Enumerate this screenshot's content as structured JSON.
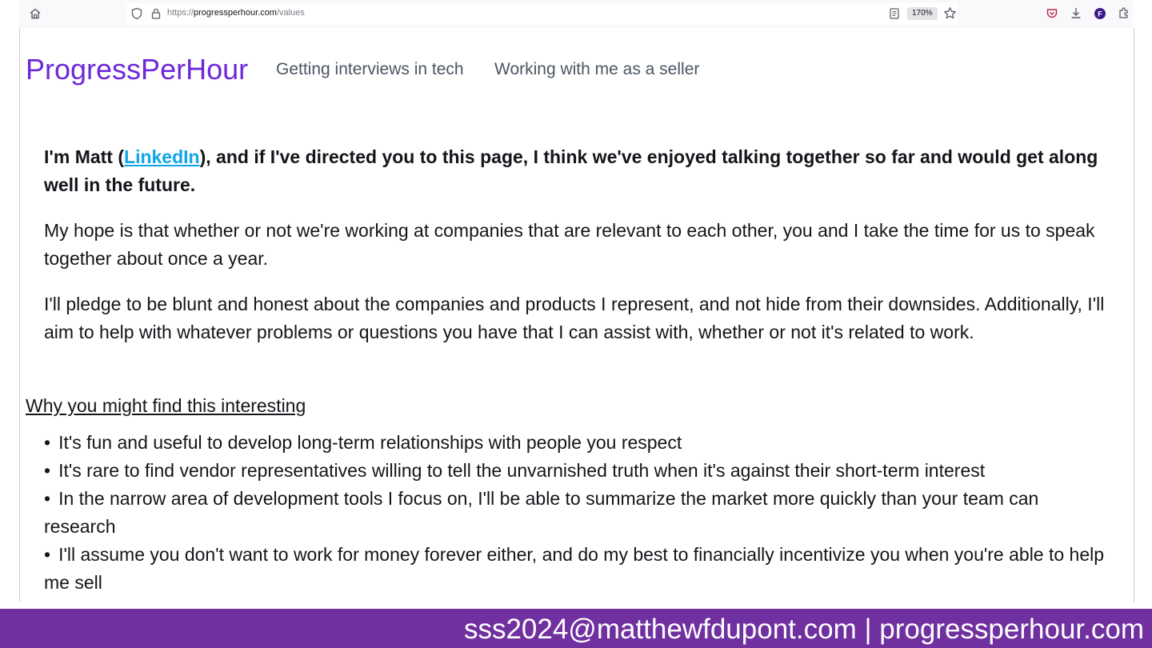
{
  "browser": {
    "url_prefix": "https://",
    "url_host": "progressperhour.com",
    "url_path": "/values",
    "zoom": "170%",
    "icons": [
      "home-icon",
      "shield-icon",
      "lock-icon",
      "reader-view-icon",
      "bookmark-star-icon",
      "pocket-icon",
      "download-icon",
      "account-icon",
      "extensions-icon"
    ],
    "account_initial": "F"
  },
  "site": {
    "brand": "ProgressPerHour",
    "nav": [
      "Getting interviews in tech",
      "Working with me as a seller"
    ]
  },
  "content": {
    "intro_before": "I'm Matt (",
    "intro_link": "LinkedIn",
    "intro_after": "), and if I've directed you to this page, I think we've enjoyed talking together so far and would get along well in the future.",
    "hope": "My hope is that whether or not we're working at companies that are relevant to each other, you and I take the time for us to speak together about once a year.",
    "pledge": "I'll pledge to be blunt and honest about the companies and products I represent, and not hide from their downsides. Additionally, I'll aim to help with whatever problems or questions you have that I can assist with, whether or not it's related to work.",
    "section_heading": "Why you might find this interesting",
    "reasons": [
      "It's fun and useful to develop long-term relationships with people you respect",
      "It's rare to find vendor representatives willing to tell the unvarnished truth when it's against their short-term interest",
      "In the narrow area of development tools I focus on, I'll be able to summarize the market more quickly than your team can research",
      "I'll assume you don't want to work for money forever either, and do my best to financially incentivize you when you're able to help me sell"
    ]
  },
  "footer": {
    "text": "sss2024@matthewfdupont.com | progressperhour.com"
  },
  "colors": {
    "brand": "#6d28d9",
    "link": "#0ea5e9",
    "footer_bg": "#7030a0",
    "nav_text": "#4b5563"
  }
}
